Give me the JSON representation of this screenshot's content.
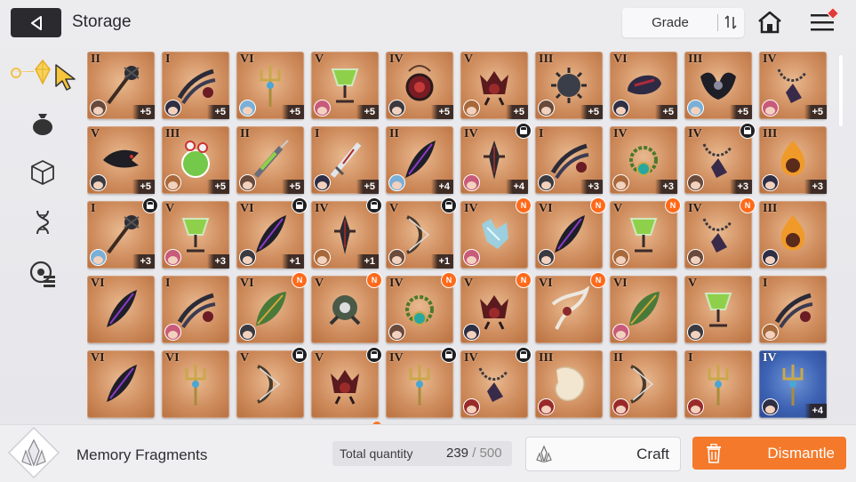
{
  "header": {
    "title": "Storage",
    "back_icon": "back-arrow-icon",
    "sort": {
      "label": "Grade",
      "icon": "sort-toggle-icon"
    },
    "home_icon": "home-icon",
    "menu_icon": "hamburger-menu-icon"
  },
  "sidebar": {
    "items": [
      {
        "name": "memory-fragments-tab",
        "icon": "diamond-fragment-icon",
        "active": true
      },
      {
        "name": "bag-tab",
        "icon": "money-bag-icon"
      },
      {
        "name": "cube-tab",
        "icon": "cube-icon"
      },
      {
        "name": "gene-tab",
        "icon": "dna-icon"
      },
      {
        "name": "device-tab",
        "icon": "target-list-icon"
      }
    ]
  },
  "items": [
    {
      "rank": "II",
      "plus": "+5",
      "art": "mace",
      "lock": false,
      "new": false
    },
    {
      "rank": "I",
      "plus": "+5",
      "art": "claw",
      "lock": false,
      "new": false
    },
    {
      "rank": "VI",
      "plus": "+5",
      "art": "trident",
      "lock": false,
      "new": false
    },
    {
      "rank": "V",
      "plus": "+5",
      "art": "goblet",
      "lock": false,
      "new": false
    },
    {
      "rank": "IV",
      "plus": "+5",
      "art": "amulet",
      "lock": false,
      "new": false
    },
    {
      "rank": "V",
      "plus": "+5",
      "art": "beast",
      "lock": false,
      "new": false
    },
    {
      "rank": "III",
      "plus": "+5",
      "art": "spikeball",
      "lock": false,
      "new": false
    },
    {
      "rank": "VI",
      "plus": "+5",
      "art": "helm",
      "lock": false,
      "new": false
    },
    {
      "rank": "III",
      "plus": "+5",
      "art": "wings",
      "lock": false,
      "new": false
    },
    {
      "rank": "IV",
      "plus": "+5",
      "art": "chain",
      "lock": false,
      "new": false
    },
    {
      "rank": "V",
      "plus": "+5",
      "art": "crow",
      "lock": false,
      "new": false
    },
    {
      "rank": "III",
      "plus": "+5",
      "art": "potion",
      "lock": false,
      "new": false
    },
    {
      "rank": "II",
      "plus": "+5",
      "art": "syringe",
      "lock": false,
      "new": false
    },
    {
      "rank": "I",
      "plus": "+5",
      "art": "sword",
      "lock": false,
      "new": false
    },
    {
      "rank": "II",
      "plus": "+4",
      "art": "feather",
      "lock": false,
      "new": false
    },
    {
      "rank": "IV",
      "plus": "+4",
      "art": "dagger",
      "lock": true,
      "new": false
    },
    {
      "rank": "I",
      "plus": "+3",
      "art": "claw",
      "lock": false,
      "new": false
    },
    {
      "rank": "IV",
      "plus": "+3",
      "art": "necklace",
      "lock": false,
      "new": false
    },
    {
      "rank": "IV",
      "plus": "+3",
      "art": "chain",
      "lock": true,
      "new": false
    },
    {
      "rank": "III",
      "plus": "+3",
      "art": "flame",
      "lock": false,
      "new": false
    },
    {
      "rank": "I",
      "plus": "+3",
      "art": "mace",
      "lock": true,
      "new": false
    },
    {
      "rank": "V",
      "plus": "+3",
      "art": "goblet",
      "lock": false,
      "new": false
    },
    {
      "rank": "VI",
      "plus": "+1",
      "art": "feather",
      "lock": true,
      "new": false
    },
    {
      "rank": "IV",
      "plus": "+1",
      "art": "dagger",
      "lock": true,
      "new": false
    },
    {
      "rank": "V",
      "plus": "+1",
      "art": "bow",
      "lock": true,
      "new": false
    },
    {
      "rank": "IV",
      "plus": "",
      "art": "crystal",
      "lock": false,
      "new": true
    },
    {
      "rank": "VI",
      "plus": "",
      "art": "feather",
      "lock": false,
      "new": true
    },
    {
      "rank": "V",
      "plus": "",
      "art": "goblet",
      "lock": false,
      "new": true
    },
    {
      "rank": "IV",
      "plus": "",
      "art": "chain",
      "lock": false,
      "new": true
    },
    {
      "rank": "III",
      "plus": "",
      "art": "flame",
      "lock": false,
      "new": false
    },
    {
      "rank": "VI",
      "plus": "",
      "art": "feather",
      "lock": false,
      "new": false
    },
    {
      "rank": "I",
      "plus": "",
      "art": "claw",
      "lock": false,
      "new": false
    },
    {
      "rank": "VI",
      "plus": "",
      "art": "leaf",
      "lock": false,
      "new": true
    },
    {
      "rank": "V",
      "plus": "",
      "art": "robot",
      "lock": false,
      "new": true
    },
    {
      "rank": "IV",
      "plus": "",
      "art": "necklace",
      "lock": false,
      "new": true
    },
    {
      "rank": "V",
      "plus": "",
      "art": "beast",
      "lock": false,
      "new": true
    },
    {
      "rank": "VI",
      "plus": "",
      "art": "ribbon",
      "lock": false,
      "new": true
    },
    {
      "rank": "VI",
      "plus": "",
      "art": "leaf",
      "lock": false,
      "new": false
    },
    {
      "rank": "V",
      "plus": "",
      "art": "goblet",
      "lock": false,
      "new": false
    },
    {
      "rank": "I",
      "plus": "",
      "art": "claw",
      "lock": false,
      "new": false
    },
    {
      "rank": "VI",
      "plus": "",
      "art": "feather",
      "lock": false,
      "new": false
    },
    {
      "rank": "VI",
      "plus": "",
      "art": "trident",
      "lock": false,
      "new": false
    },
    {
      "rank": "V",
      "plus": "",
      "art": "bow",
      "lock": true,
      "new": false
    },
    {
      "rank": "V",
      "plus": "",
      "art": "beast",
      "lock": true,
      "new": false
    },
    {
      "rank": "IV",
      "plus": "",
      "art": "trident",
      "lock": true,
      "new": false
    },
    {
      "rank": "IV",
      "plus": "",
      "art": "chain",
      "lock": true,
      "new": false
    },
    {
      "rank": "III",
      "plus": "",
      "art": "orb",
      "lock": false,
      "new": false
    },
    {
      "rank": "II",
      "plus": "",
      "art": "bow",
      "lock": false,
      "new": false
    },
    {
      "rank": "I",
      "plus": "",
      "art": "trident",
      "lock": false,
      "new": false
    },
    {
      "rank": "IV",
      "plus": "+4",
      "art": "trident",
      "lock": false,
      "new": false,
      "blue": true
    }
  ],
  "badges": {
    "new_label": "N"
  },
  "footer": {
    "fragment_icon": "memory-fragment-icon",
    "fragment_name": "Memory Fragments",
    "quantity_label": "Total quantity",
    "quantity_current": "239",
    "quantity_sep": " / ",
    "quantity_max": "500",
    "craft_label": "Craft",
    "craft_icon": "fragment-craft-icon",
    "dismantle_label": "Dismantle",
    "dismantle_icon": "trash-icon"
  }
}
